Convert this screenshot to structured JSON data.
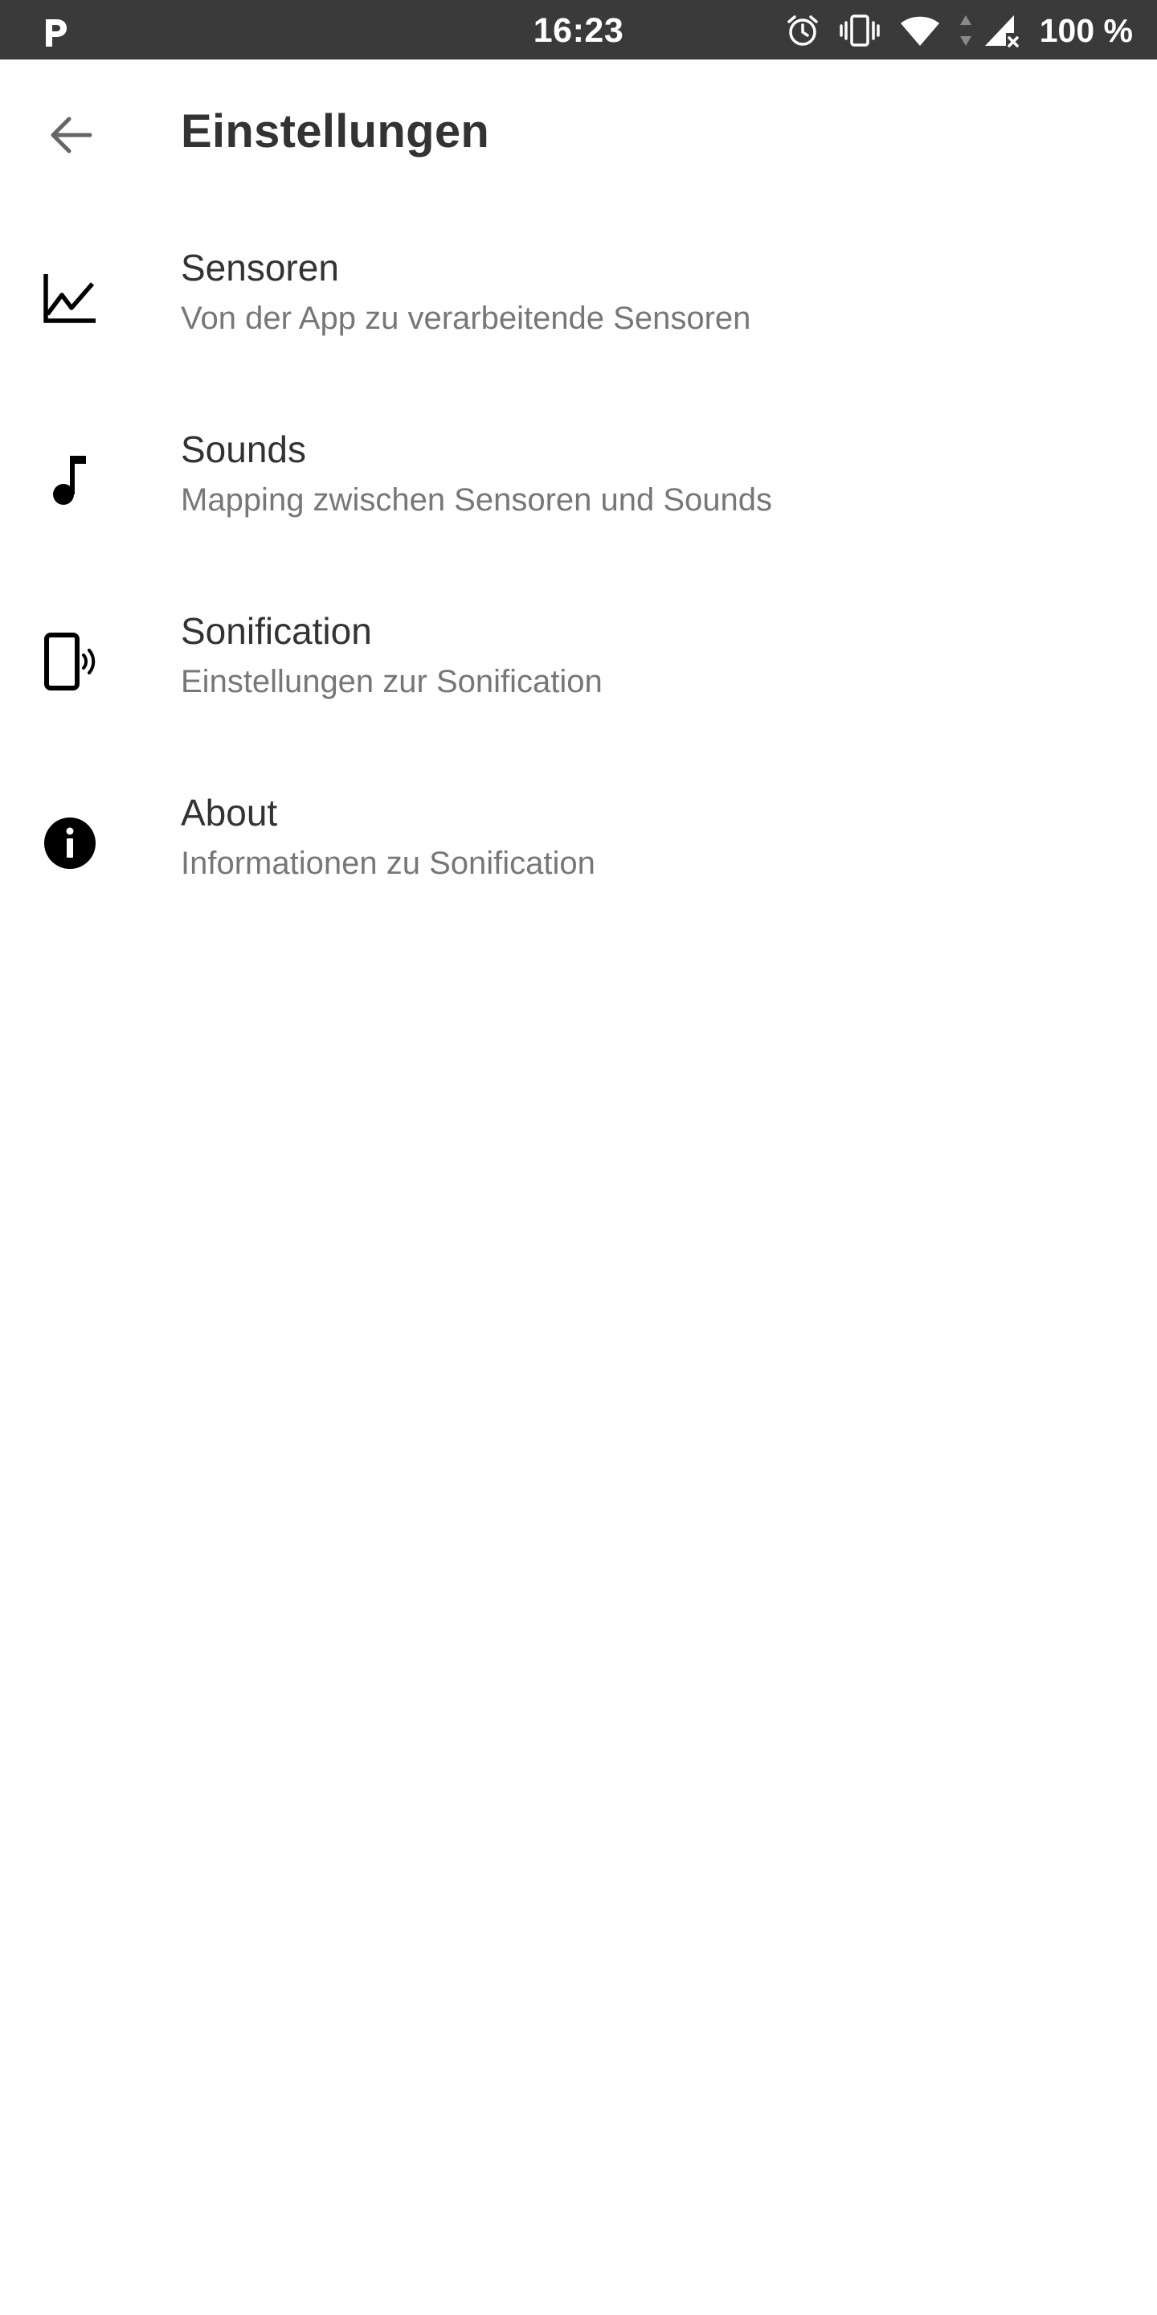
{
  "status_bar": {
    "left_icon": "parking-p-icon",
    "time": "16:23",
    "icons": [
      "alarm-icon",
      "vibrate-icon",
      "wifi-icon",
      "data-arrows-icon",
      "signal-icon"
    ],
    "battery": "100 %"
  },
  "toolbar": {
    "back_icon": "arrow-left-icon",
    "title": "Einstellungen"
  },
  "preferences": [
    {
      "icon": "line-chart-icon",
      "title": "Sensoren",
      "summary": "Von der App zu verarbeitende Sensoren"
    },
    {
      "icon": "music-note-icon",
      "title": "Sounds",
      "summary": "Mapping zwischen Sensoren und Sounds"
    },
    {
      "icon": "phone-ring-icon",
      "title": "Sonification",
      "summary": "Einstellungen zur Sonification"
    },
    {
      "icon": "info-icon",
      "title": "About",
      "summary": "Informationen zu Sonification"
    }
  ],
  "colors": {
    "status_bar_bg": "#3a3a3a",
    "background": "#ffffff",
    "title_text": "#333333",
    "summary_text": "#777777",
    "icon": "#000000"
  }
}
